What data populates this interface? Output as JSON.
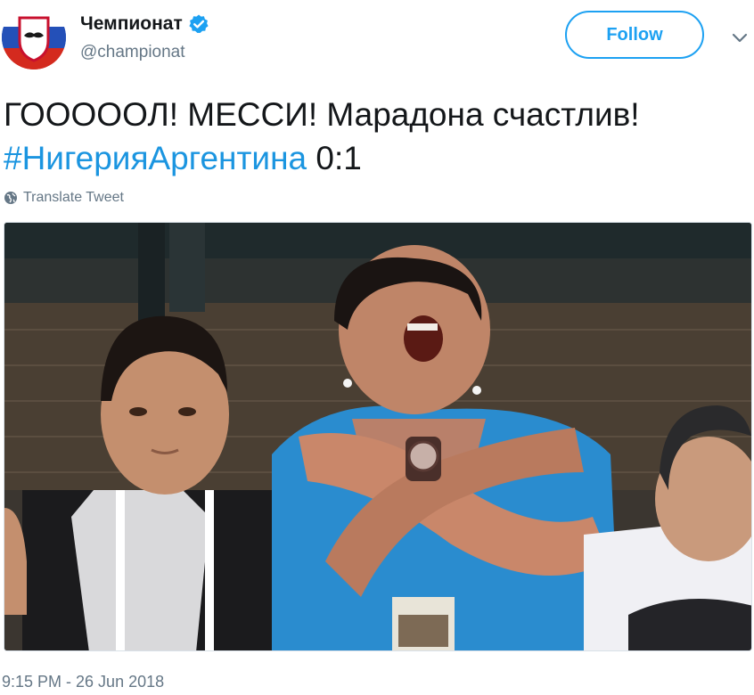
{
  "tweet": {
    "author": {
      "display_name": "Чемпионат",
      "handle": "@championat",
      "verified": true,
      "avatar_icon": "championat-logo"
    },
    "follow_label": "Follow",
    "more_icon": "chevron-down-icon",
    "text_line1": "ГОООООЛ! МЕССИ! Марадона счастлив!",
    "hashtag": "#НигерияАргентина",
    "score": " 0:1",
    "translate_label": "Translate Tweet",
    "translate_icon": "globe-icon",
    "timestamp": "9:15 PM - 26 Jun 2018"
  },
  "colors": {
    "link": "#1b95e0",
    "follow_border": "#1da1f2",
    "secondary_text": "#657786",
    "primary_text": "#14171a",
    "verified_badge": "#1da1f2"
  }
}
